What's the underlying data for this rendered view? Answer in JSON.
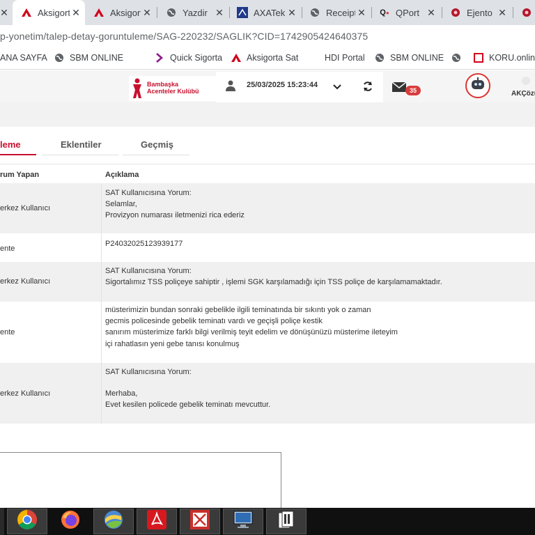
{
  "browser": {
    "tabs": [
      {
        "title": "",
        "icon": "close-x"
      },
      {
        "title": "Aksigorta",
        "icon": "aksigorta-logo-icon",
        "active": true
      },
      {
        "title": "Aksigorta",
        "icon": "aksigorta-logo-icon"
      },
      {
        "title": "Yazdir",
        "icon": "globe-icon"
      },
      {
        "title": "AXATek",
        "icon": "axa-logo-icon"
      },
      {
        "title": "Receipt",
        "icon": "globe-icon"
      },
      {
        "title": "QPort",
        "icon": "qport-logo-icon"
      },
      {
        "title": "Ejento",
        "icon": "ejento-logo-icon"
      },
      {
        "title": "",
        "icon": "ejento-logo-icon"
      }
    ],
    "url": "p-yonetim/talep-detay-goruntuleme/SAG-220232/SAGLIK?CID=1742905424640375",
    "bookmarks": [
      {
        "label": "ANA SAYFA",
        "icon": ""
      },
      {
        "label": "SBM ONLINE",
        "icon": "globe-icon"
      },
      {
        "label": "Quick Sigorta",
        "icon": "quick-logo-icon"
      },
      {
        "label": "Aksigorta Sat",
        "icon": "aksigorta-logo-icon"
      },
      {
        "label": "HDI Portal",
        "icon": ""
      },
      {
        "label": "SBM ONLINE",
        "icon": "globe-icon"
      },
      {
        "label": "",
        "icon": "globe-icon"
      },
      {
        "label": "KORU.online",
        "icon": "koru-logo-icon"
      }
    ]
  },
  "header": {
    "logo_line1": "Bambaşka",
    "logo_line2": "Acenteler Kulübü",
    "datetime": "25/03/2025 15:23:44",
    "message_count": "35",
    "username": "AKÇözü"
  },
  "page_tabs": {
    "active": "leme",
    "tab2": "Eklentiler",
    "tab3": "Geçmiş"
  },
  "table": {
    "col1": "rum Yapan",
    "col2": "Açıklama",
    "rows": [
      {
        "who": "erkez Kullanıcı",
        "lines": [
          "SAT Kullanıcısına Yorum:",
          "Selamlar,",
          "Provizyon numarası iletmenizi rica ederiz"
        ]
      },
      {
        "who": "ente",
        "lines": [
          "P24032025123939177"
        ]
      },
      {
        "who": "erkez Kullanıcı",
        "lines": [
          "SAT Kullanıcısına Yorum:",
          "Sigortalımız TSS poliçeye sahiptir , işlemi SGK karşılamadığı için TSS poliçe de karşılamamaktadır."
        ]
      },
      {
        "who": "ente",
        "lines": [
          "müsterimizin bundan sonraki gebelikle ilgili teminatında bir sıkıntı yok o zaman",
          "gecmis policesinde gebelik teminatı vardı ve geçişli poliçe kestik",
          "sanırım müsterimize farklı bilgi verilmiş teyit edelim ve dönüşünüzü müsterime ileteyim",
          "içi rahatlasın yeni gebe tanısı konulmuş"
        ]
      },
      {
        "who": "erkez Kullanıcı",
        "lines": [
          "SAT Kullanıcısına Yorum:",
          "",
          "Merhaba,",
          "Evet kesilen policede gebelik teminatı mevcuttur."
        ]
      }
    ]
  },
  "taskbar": {
    "apps": [
      "chrome-icon",
      "firefox-icon",
      "google-earth-icon",
      "acrobat-icon",
      "image-editor-icon",
      "monitor-icon",
      "file-manager-icon"
    ]
  }
}
